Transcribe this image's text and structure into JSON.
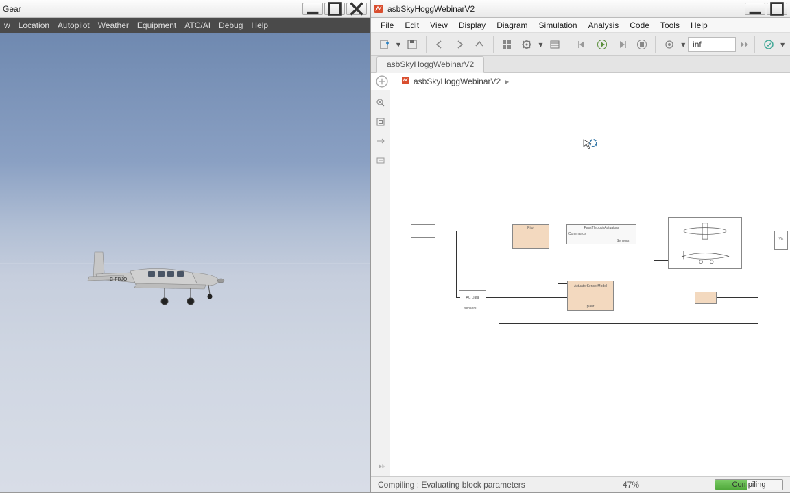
{
  "flightgear": {
    "title": "Gear",
    "menu": [
      "w",
      "Location",
      "Autopilot",
      "Weather",
      "Equipment",
      "ATC/AI",
      "Debug",
      "Help"
    ],
    "aircraft_reg": "C-FBJO"
  },
  "simulink": {
    "title": "asbSkyHoggWebinarV2",
    "menu": [
      "File",
      "Edit",
      "View",
      "Display",
      "Diagram",
      "Simulation",
      "Analysis",
      "Code",
      "Tools",
      "Help"
    ],
    "stop_time": "inf",
    "tab": "asbSkyHoggWebinarV2",
    "breadcrumb": "asbSkyHoggWebinarV2",
    "blocks": {
      "pilot": "Pilot",
      "actuators": "PassThroughActuators",
      "actuator_commands": "Commands",
      "actuator_sensors": "Sensors",
      "act_data": "AC Data",
      "sensors": "sensors",
      "actuator_sensor_model": "ActuatorSensorModel",
      "plant": "plant",
      "vehicle": "Vehicle",
      "vis_port": "Viz"
    },
    "status": {
      "text": "Compiling : Evaluating block parameters",
      "percent": "47%",
      "progress_width": "47%",
      "label": "Compiling"
    }
  }
}
